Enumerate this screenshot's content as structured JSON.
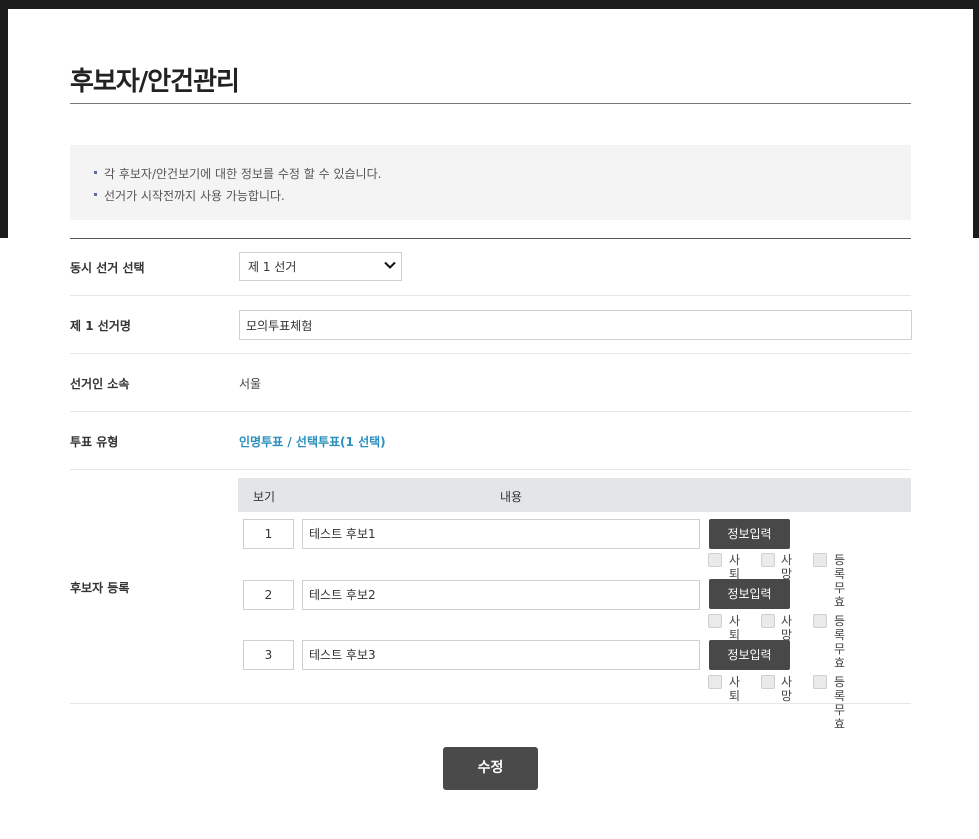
{
  "page": {
    "title": "후보자/안건관리"
  },
  "notice": [
    "각 후보자/안건보기에 대한 정보를 수정 할 수 있습니다.",
    "선거가 시작전까지 사용 가능합니다."
  ],
  "form": {
    "simultaneous_label": "동시 선거 선택",
    "simultaneous_value": "제 1 선거",
    "election_name_label": "제 1 선거명",
    "election_name_value": "모의투표체험",
    "affiliation_label": "선거인 소속",
    "affiliation_value": "서울",
    "vote_type_label": "투표 유형",
    "vote_type_value": "인명투표 / 선택투표(1 선택)",
    "candidate_label": "후보자 등록"
  },
  "candidates": {
    "header_view": "보기",
    "header_content": "내용",
    "info_button": "정보입력",
    "checkbox_labels": [
      "사퇴",
      "사망",
      "등록무효"
    ],
    "rows": [
      {
        "number": "1",
        "name": "테스트 후보1"
      },
      {
        "number": "2",
        "name": "테스트 후보2"
      },
      {
        "number": "3",
        "name": "테스트 후보3"
      }
    ]
  },
  "submit_label": "수정",
  "colors": {
    "accent": "#2a8fbd",
    "button": "#484848",
    "header_bg": "#e2e6e8"
  }
}
